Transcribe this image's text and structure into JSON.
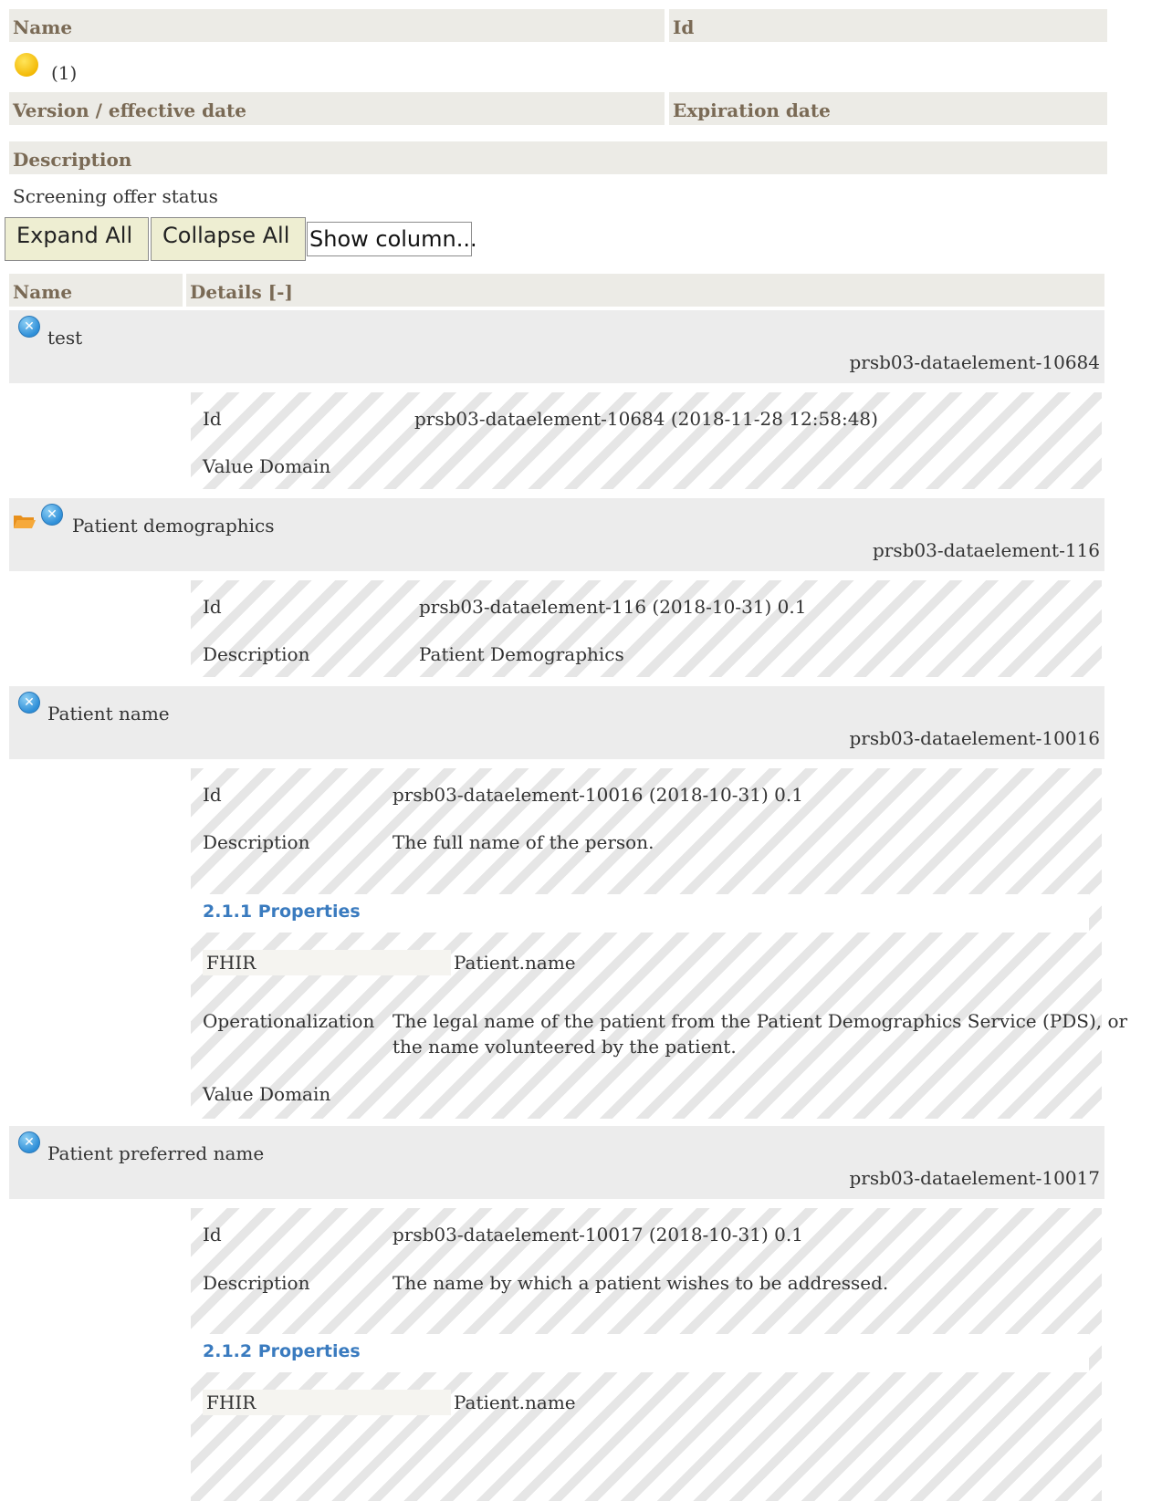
{
  "header": {
    "name_label": "Name",
    "id_label": "Id",
    "status_count": "(1)",
    "version_label": "Version / effective date",
    "expiration_label": "Expiration date",
    "description_label": "Description",
    "description_value": "Screening offer status"
  },
  "toolbar": {
    "expand_all": "Expand All",
    "collapse_all": "Collapse All",
    "show_column": "Show column..."
  },
  "table": {
    "col_name": "Name",
    "col_details": "Details [-]"
  },
  "items": [
    {
      "name": "test",
      "id_right": "prsb03-dataelement-10684",
      "details": [
        {
          "label": "Id",
          "value": "prsb03-dataelement-10684 (2018-11-28 12:58:48)"
        },
        {
          "label": "Value Domain",
          "value": ""
        }
      ]
    },
    {
      "name": "Patient demographics",
      "id_right": "prsb03-dataelement-116",
      "details": [
        {
          "label": "Id",
          "value": "prsb03-dataelement-116 (2018-10-31) 0.1"
        },
        {
          "label": "Description",
          "value": "Patient Demographics"
        }
      ]
    },
    {
      "name": "Patient name",
      "id_right": "prsb03-dataelement-10016",
      "details": [
        {
          "label": "Id",
          "value": "prsb03-dataelement-10016 (2018-10-31) 0.1"
        },
        {
          "label": "Description",
          "value": "The full name of the person."
        }
      ],
      "properties_title": "2.1.1 Properties",
      "fhir_label": "FHIR",
      "fhir_value": "Patient.name",
      "operationalization_label": "Operationalization",
      "operationalization_value_1": "The legal name of the patient from the Patient Demographics Service (PDS), or",
      "operationalization_value_2": "the name volunteered by the patient.",
      "value_domain_label": "Value Domain"
    },
    {
      "name": "Patient preferred name",
      "id_right": "prsb03-dataelement-10017",
      "details": [
        {
          "label": "Id",
          "value": "prsb03-dataelement-10017 (2018-10-31) 0.1"
        },
        {
          "label": "Description",
          "value": "The name by which a patient wishes to be addressed."
        }
      ],
      "properties_title": "2.1.2 Properties",
      "fhir_label": "FHIR",
      "fhir_value": "Patient.name"
    }
  ]
}
